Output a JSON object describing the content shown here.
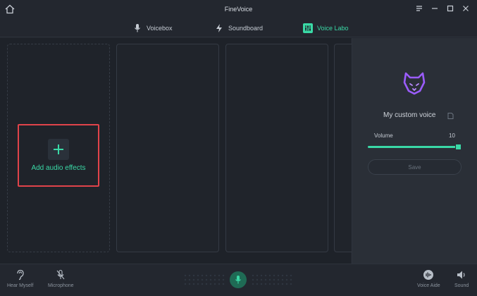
{
  "window": {
    "title": "FineVoice",
    "home_icon": "home-icon",
    "controls": [
      "menu-icon",
      "minimize-icon",
      "maximize-icon",
      "close-icon"
    ]
  },
  "tabs": [
    {
      "label": "Voicebox",
      "icon": "microphone-icon",
      "active": false
    },
    {
      "label": "Soundboard",
      "icon": "lightning-icon",
      "active": false
    },
    {
      "label": "Voice Labo",
      "icon": "sliders-icon",
      "active": true
    }
  ],
  "workspace": {
    "add_effects_label": "Add audio effects",
    "add_icon": "plus-icon"
  },
  "panel": {
    "voice_name": "My custom voice",
    "volume_label": "Volume",
    "volume_value": "10",
    "volume_fraction": 1.0,
    "save_label": "Save"
  },
  "bottom": {
    "hear_myself": "Hear Myself",
    "microphone": "Microphone",
    "voice_aide": "Voice Aide",
    "sound": "Sound"
  },
  "colors": {
    "accent": "#3ad9a6",
    "highlight_border": "#e0434a",
    "mascot": "#9b5cff"
  }
}
